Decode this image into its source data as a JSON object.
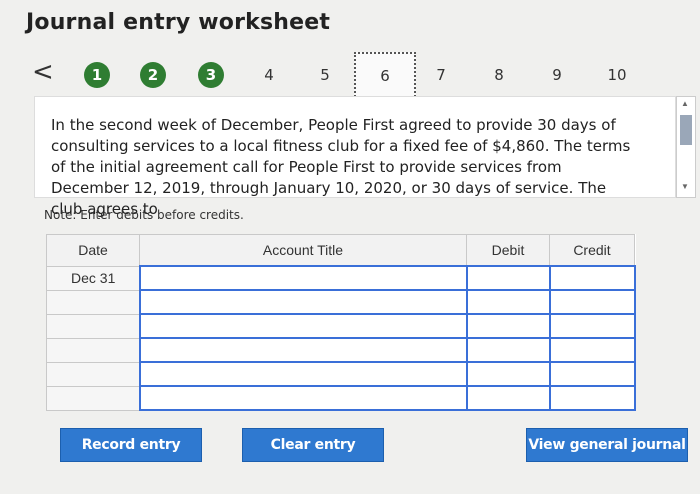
{
  "title": "Journal entry worksheet",
  "pager": {
    "prev": "<",
    "steps": [
      "1",
      "2",
      "3",
      "4",
      "5",
      "6",
      "7",
      "8",
      "9",
      "10"
    ],
    "current_step": "6"
  },
  "problem_text": "In the second week of December, People First agreed to provide 30 days of consulting services to a local fitness club for a fixed fee of $4,860. The terms of the initial agreement call for People First to provide services from December 12, 2019, through January 10, 2020, or 30 days of service. The club agrees to",
  "note": "Note: Enter debits before credits.",
  "table": {
    "headers": [
      "Date",
      "Account Title",
      "Debit",
      "Credit"
    ],
    "rows": [
      [
        "Dec 31",
        "",
        "",
        ""
      ],
      [
        "",
        "",
        "",
        ""
      ],
      [
        "",
        "",
        "",
        ""
      ],
      [
        "",
        "",
        "",
        ""
      ],
      [
        "",
        "",
        "",
        ""
      ],
      [
        "",
        "",
        "",
        ""
      ]
    ]
  },
  "buttons": {
    "record": "Record entry",
    "clear": "Clear entry",
    "view": "View general journal"
  }
}
